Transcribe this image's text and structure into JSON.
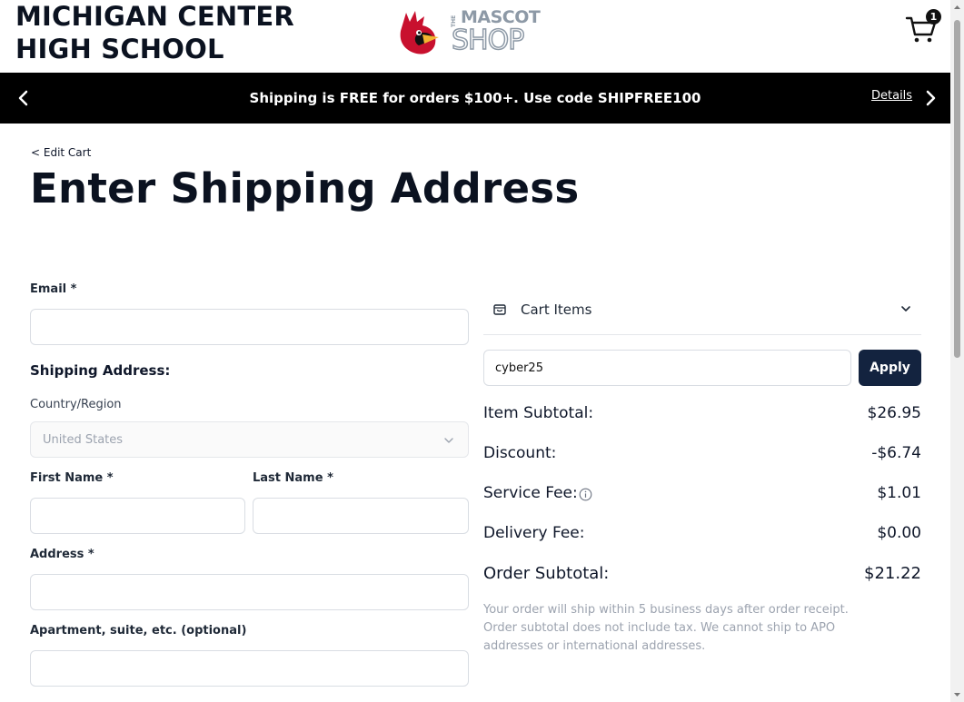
{
  "header": {
    "school_name": "MICHIGAN CENTER\nHIGH SCHOOL",
    "logo": {
      "small_text": "THE",
      "line1": "MASCOT",
      "line2": "SHOP",
      "icon": "cardinal-mascot-icon"
    },
    "cart_count": "1",
    "cart_icon": "shopping-cart-icon"
  },
  "banner": {
    "text": "Shipping is FREE for orders $100+. Use code SHIPFREE100",
    "details_link": "Details",
    "prev_icon": "chevron-left-icon",
    "next_icon": "chevron-right-icon"
  },
  "nav": {
    "edit_cart": "< Edit Cart"
  },
  "page_title": "Enter Shipping Address",
  "form": {
    "email_label": "Email *",
    "email_value": "",
    "shipping_heading": "Shipping Address:",
    "country_label": "Country/Region",
    "country_value": "United States",
    "first_name_label": "First Name *",
    "last_name_label": "Last Name *",
    "address_label": "Address *",
    "apartment_label": "Apartment, suite, etc. (optional)"
  },
  "summary": {
    "cart_items_label": "Cart Items",
    "promo_value": "cyber25",
    "apply_label": "Apply",
    "rows": [
      {
        "label": "Item Subtotal:",
        "value": "$26.95"
      },
      {
        "label": "Discount:",
        "value": "-$6.74"
      },
      {
        "label": "Service Fee:",
        "value": "$1.01"
      },
      {
        "label": "Delivery Fee:",
        "value": "$0.00"
      },
      {
        "label": "Order Subtotal:",
        "value": "$21.22"
      }
    ],
    "note": "Your order will ship within 5 business days after order receipt. Order subtotal does not include tax. We cannot ship to APO addresses or international addresses."
  },
  "colors": {
    "banner_bg": "#000000",
    "button_bg": "#13233f",
    "mascot_red": "#c8102e",
    "logo_grey": "#8d99a6"
  }
}
